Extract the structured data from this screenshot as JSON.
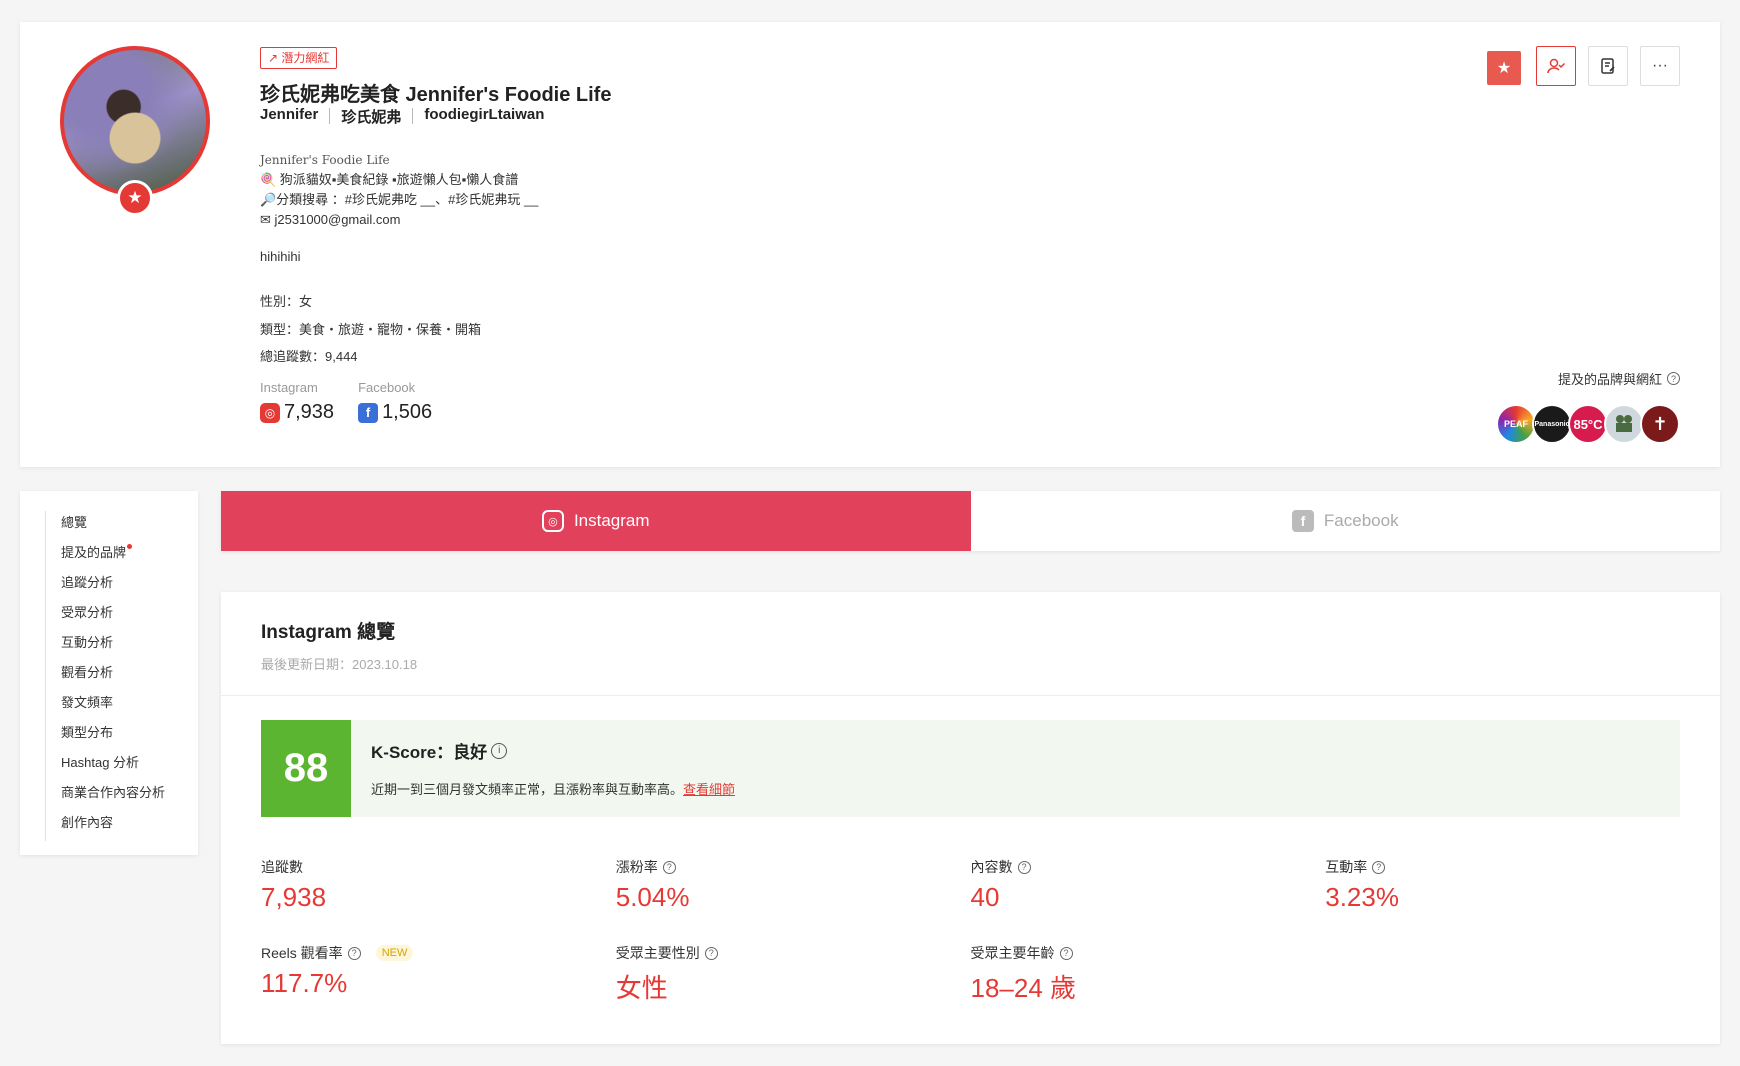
{
  "profile": {
    "tag": "潛力網紅",
    "name": "珍氏妮弗吃美食 Jennifer's Foodie Life",
    "aliases": [
      "Jennifer",
      "珍氏妮弗",
      "foodiegirLtaiwan"
    ],
    "bio_title": "Jennifer's Foodie Life",
    "bio_lines": [
      "🍭 狗派貓奴▪美食紀錄 ▪旅遊懶人包▪懶人食譜",
      "🔎分類搜尋 ：#珍氏妮弗吃 __、#珍氏妮弗玩 __",
      "✉ j2531000@gmail.com"
    ],
    "extra": "hihihihi",
    "gender": "性別：女",
    "categories": "類型：美食・旅遊・寵物・保養・開箱",
    "total_followers": "總追蹤數：9,444",
    "instagram_label": "Instagram",
    "instagram_followers": "7,938",
    "facebook_label": "Facebook",
    "facebook_followers": "1,506",
    "mentioned_label": "提及的品牌與網紅",
    "brand_logos": [
      "PEAF",
      "Panasonic",
      "85°C",
      "",
      ""
    ]
  },
  "sidenav": {
    "items": [
      "總覽",
      "提及的品牌",
      "追蹤分析",
      "受眾分析",
      "互動分析",
      "觀看分析",
      "發文頻率",
      "類型分布",
      "Hashtag 分析",
      "商業合作內容分析",
      "創作內容"
    ]
  },
  "tabs": {
    "instagram": "Instagram",
    "facebook": "Facebook"
  },
  "overview": {
    "title": "Instagram 總覽",
    "updated": "最後更新日期：2023.10.18",
    "kscore_value": "88",
    "kscore_title": "K-Score：良好",
    "kscore_desc": "近期一到三個月發文頻率正常，且漲粉率與互動率高。",
    "kscore_link": "查看細節",
    "metrics": {
      "followers_label": "追蹤數",
      "followers_value": "7,938",
      "growth_label": "漲粉率",
      "growth_value": "5.04%",
      "posts_label": "內容數",
      "posts_value": "40",
      "engagement_label": "互動率",
      "engagement_value": "3.23%",
      "reels_label": "Reels 觀看率",
      "reels_new": "NEW",
      "reels_value": "117.7%",
      "gender_label": "受眾主要性別",
      "gender_value": "女性",
      "age_label": "受眾主要年齡",
      "age_value": "18–24 歲"
    }
  },
  "colors": {
    "accent": "#e53935",
    "tab_active": "#e2415c",
    "kscore_green": "#5cb531"
  }
}
